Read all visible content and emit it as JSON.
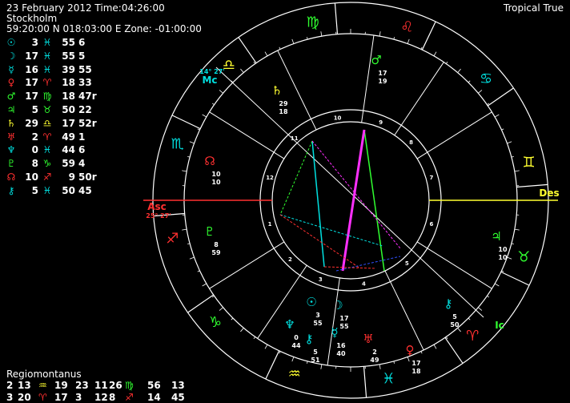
{
  "header": {
    "date_time": "23 February 2012 Time:04:26:00",
    "place": "Stockholm",
    "coords": "59:20:00 N 018:03:00 E Zone: -01:00:00",
    "mode": "Tropical True"
  },
  "planets": [
    {
      "symbol": "☉",
      "deg": "3",
      "sign": "♓",
      "min": "55",
      "sec": "6",
      "color": "#00e0e0"
    },
    {
      "symbol": "☽",
      "deg": "17",
      "sign": "♓",
      "min": "55",
      "sec": "5",
      "color": "#00e0e0"
    },
    {
      "symbol": "☿",
      "deg": "16",
      "sign": "♓",
      "min": "39",
      "sec": "55",
      "color": "#00e0e0"
    },
    {
      "symbol": "♀",
      "deg": "17",
      "sign": "♈",
      "min": "18",
      "sec": "33",
      "color": "#ff3030"
    },
    {
      "symbol": "♂",
      "deg": "17",
      "sign": "♍",
      "min": "18",
      "sec": "47r",
      "color": "#30ff30"
    },
    {
      "symbol": "♃",
      "deg": "5",
      "sign": "♉",
      "min": "50",
      "sec": "22",
      "color": "#30ff30"
    },
    {
      "symbol": "♄",
      "deg": "29",
      "sign": "♎",
      "min": "17",
      "sec": "52r",
      "color": "#ffff30"
    },
    {
      "symbol": "♅",
      "deg": "2",
      "sign": "♈",
      "min": "49",
      "sec": "1",
      "color": "#ff3030"
    },
    {
      "symbol": "♆",
      "deg": "0",
      "sign": "♓",
      "min": "44",
      "sec": "6",
      "color": "#00e0e0"
    },
    {
      "symbol": "♇",
      "deg": "8",
      "sign": "♑",
      "min": "59",
      "sec": "4",
      "color": "#30ff30"
    },
    {
      "symbol": "☊",
      "deg": "10",
      "sign": "♐",
      "min": "9",
      "sec": "50r",
      "color": "#ff3030"
    },
    {
      "symbol": "⚷",
      "deg": "5",
      "sign": "♓",
      "min": "50",
      "sec": "45",
      "color": "#00e0e0"
    }
  ],
  "houses": {
    "title": "Regiomontanus",
    "rows": [
      [
        "2",
        "13",
        "♒",
        "19",
        "23",
        "11",
        "26",
        "♍",
        "56",
        "13"
      ],
      [
        "3",
        "20",
        "♈",
        "17",
        "3",
        "12",
        "8",
        "♐",
        "14",
        "45"
      ]
    ],
    "sign_colors": [
      [
        "#ffff30",
        "#30ff30"
      ],
      [
        "#ff3030",
        "#ff3030"
      ]
    ]
  },
  "chart": {
    "labels": {
      "asc": "Asc",
      "asc_deg": "25° 27'",
      "des": "Des",
      "mc": "Mc",
      "mc_deg": "14° 27'",
      "ic": "Ic"
    },
    "house_numbers": [
      "1",
      "2",
      "3",
      "4",
      "5",
      "6",
      "7",
      "8",
      "9",
      "10",
      "11",
      "12"
    ],
    "zodiac": [
      {
        "glyph": "♎",
        "color": "#ffff30"
      },
      {
        "glyph": "♍",
        "color": "#30ff30"
      },
      {
        "glyph": "♌",
        "color": "#ff3030"
      },
      {
        "glyph": "♋",
        "color": "#00e0e0"
      },
      {
        "glyph": "♊",
        "color": "#ffff30"
      },
      {
        "glyph": "♉",
        "color": "#30ff30"
      },
      {
        "glyph": "♈",
        "color": "#ff3030"
      },
      {
        "glyph": "♓",
        "color": "#00e0e0"
      },
      {
        "glyph": "♒",
        "color": "#ffff30"
      },
      {
        "glyph": "♑",
        "color": "#30ff30"
      },
      {
        "glyph": "♐",
        "color": "#ff3030"
      },
      {
        "glyph": "♏",
        "color": "#00e0e0"
      }
    ],
    "placed_planets": [
      {
        "name": "mars",
        "glyph": "♂",
        "color": "#30ff30",
        "deg": "17",
        "min": "19"
      },
      {
        "name": "saturn",
        "glyph": "♄",
        "color": "#ffff30",
        "deg": "29",
        "min": "18"
      },
      {
        "name": "node",
        "glyph": "☊",
        "color": "#ff3030",
        "deg": "10",
        "min": "10"
      },
      {
        "name": "pluto",
        "glyph": "♇",
        "color": "#30ff30",
        "deg": "8",
        "min": "59"
      },
      {
        "name": "jupiter",
        "glyph": "♃",
        "color": "#30ff30",
        "deg": "10",
        "min": "10"
      },
      {
        "name": "sun",
        "glyph": "☉",
        "color": "#00e0e0",
        "deg": "3",
        "min": "55"
      },
      {
        "name": "moon",
        "glyph": "☽",
        "color": "#00e0e0",
        "deg": "17",
        "min": "55"
      },
      {
        "name": "neptune",
        "glyph": "♆",
        "color": "#00e0e0",
        "deg": "0",
        "min": "44"
      },
      {
        "name": "chiron",
        "glyph": "⚷",
        "color": "#00e0e0",
        "deg": "5",
        "min": "51"
      },
      {
        "name": "mercury",
        "glyph": "☿",
        "color": "#00e0e0",
        "deg": "16",
        "min": "40"
      },
      {
        "name": "uranus",
        "glyph": "♅",
        "color": "#ff3030",
        "deg": "2",
        "min": "49"
      },
      {
        "name": "venus",
        "glyph": "♀",
        "color": "#ff3030",
        "deg": "17",
        "min": "18"
      },
      {
        "name": "chiron2",
        "glyph": "⚷",
        "color": "#00e0e0",
        "deg": "5",
        "min": "50"
      }
    ]
  }
}
